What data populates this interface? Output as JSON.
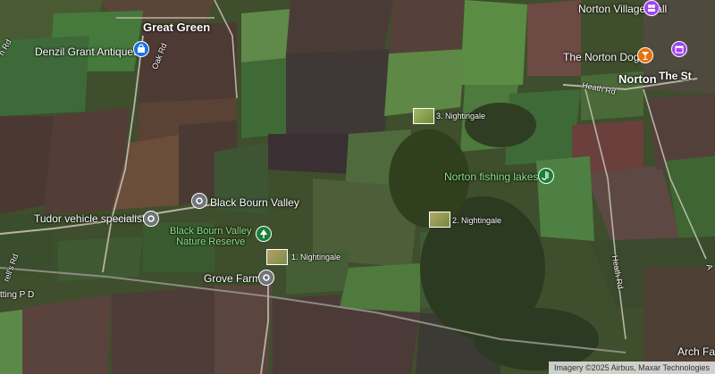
{
  "places": {
    "great_green": "Great Green",
    "norton": "Norton",
    "norton_village_hall": "Norton Village Hall",
    "the_norton_dog": "The Norton Dog",
    "the_st": "The St",
    "denzil_grant": "Denzil Grant Antiques",
    "tudor": "Tudor vehicle specialist",
    "black_bourn_valley": "Black Bourn Valley",
    "nature_reserve_1": "Black Bourn Valley",
    "nature_reserve_2": "Nature Reserve",
    "grove_farm": "Grove Farm",
    "fishing_lakes": "Norton fishing lakes",
    "arch_farm": "Arch Far"
  },
  "roads": {
    "oak_rd": "Oak Rd",
    "heath_rd_top": "Heath Rd",
    "heath_rd_side": "Heath Rd",
    "h_rd": "h Rd",
    "rells_rd": "rell's Rd",
    "tting_pd": "tting P D",
    "a_edge": "A"
  },
  "photos": {
    "n1": "1. Nightingale",
    "n2": "2. Nightingale",
    "n3": "3. Nightingale"
  },
  "attribution": "Imagery ©2025 Airbus, Maxar Technologies",
  "colors": {
    "pin_blue": "#1a73e8",
    "pin_gray": "#70757a",
    "pin_green": "#188038",
    "pin_orange": "#e8710a",
    "pin_purple": "#a142f4",
    "pin_teal": "#12b5cb"
  },
  "icons": {
    "denzil": "shopping-bag-icon",
    "hall": "community-icon",
    "dog": "cocktail-icon",
    "norton_extra": "event-icon",
    "fishing": "fishing-icon",
    "reserve": "tree-icon",
    "generic": "map-pin-icon"
  }
}
